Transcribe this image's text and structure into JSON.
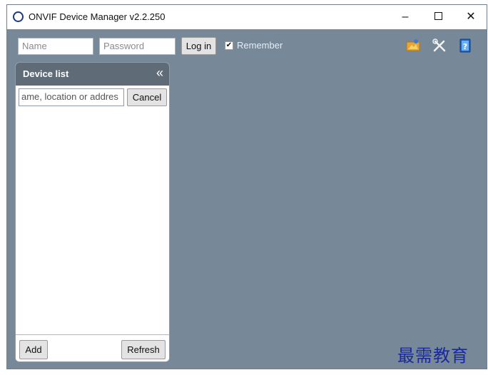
{
  "window": {
    "title": "ONVIF Device Manager v2.2.250",
    "minimize": "–",
    "close": "✕"
  },
  "toolbar": {
    "name_placeholder": "Name",
    "password_placeholder": "Password",
    "login_label": "Log in",
    "remember_label": "Remember",
    "remember_checked": true,
    "icons": [
      "gallery-icon",
      "tools-icon",
      "help-icon"
    ]
  },
  "device_list": {
    "title": "Device list",
    "collapse_glyph": "«",
    "search_value": "ame, location or addres",
    "cancel_label": "Cancel",
    "add_label": "Add",
    "refresh_label": "Refresh"
  },
  "watermark": "最需教育",
  "colors": {
    "workspace": "#778899",
    "panel_header": "#5f6b77",
    "watermark": "#1a2a9a"
  }
}
